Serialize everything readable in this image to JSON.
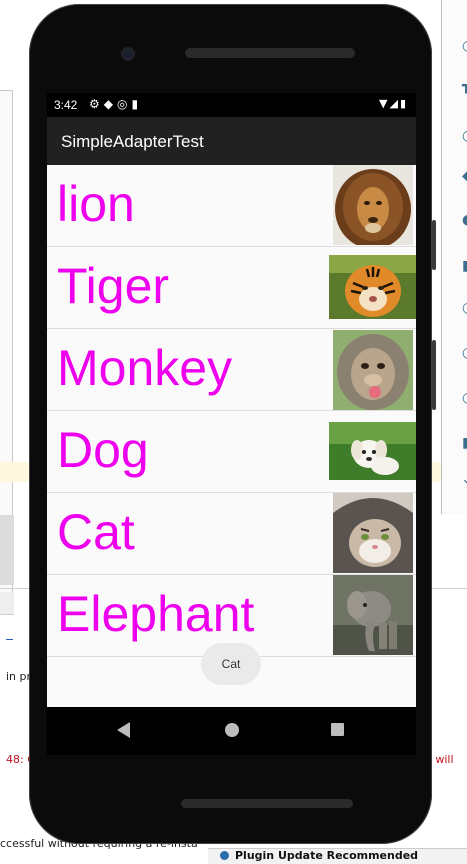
{
  "status_bar": {
    "time": "3:42",
    "left_icons": [
      "settings-icon",
      "wifi-off-icon",
      "at-icon",
      "sd-card-icon"
    ],
    "right_icons": [
      "wifi-icon",
      "signal-icon",
      "battery-icon"
    ]
  },
  "app_bar": {
    "title": "SimpleAdapterTest"
  },
  "list": {
    "items": [
      {
        "label": "lion",
        "image": "lion-photo"
      },
      {
        "label": "Tiger",
        "image": "tiger-photo"
      },
      {
        "label": "Monkey",
        "image": "monkey-photo"
      },
      {
        "label": "Dog",
        "image": "dog-photo"
      },
      {
        "label": "Cat",
        "image": "cat-photo"
      },
      {
        "label": "Elephant",
        "image": "elephant-photo"
      }
    ]
  },
  "toast": {
    "text": "Cat"
  },
  "nav_bar": {
    "icons": [
      "back-icon",
      "home-icon",
      "recents-icon"
    ]
  },
  "ide_background": {
    "fragment_1": "in pr",
    "error_fragment_left": "48: C",
    "error_fragment_right": "ity will",
    "bottom_text": "ccessful without requiring a re-insta",
    "notification": "Plugin Update Recommended"
  },
  "colors": {
    "label_color": "#ee00ee",
    "app_bar": "#212121",
    "screen_bg": "#fafafa"
  }
}
